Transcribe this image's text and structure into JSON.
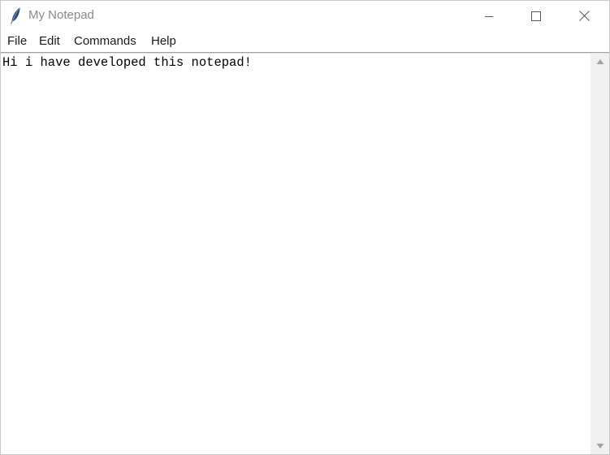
{
  "window": {
    "title": "My Notepad",
    "app_icon": "feather-icon",
    "controls": {
      "minimize_icon": "minimize-icon",
      "maximize_icon": "maximize-icon",
      "close_icon": "close-icon"
    }
  },
  "menubar": {
    "items": [
      {
        "label": "File"
      },
      {
        "label": "Edit"
      },
      {
        "label": "Commands"
      },
      {
        "label": "Help"
      }
    ]
  },
  "editor": {
    "content": "Hi i have developed this notepad!"
  },
  "scrollbar": {
    "up_icon": "scroll-up-arrow-icon",
    "down_icon": "scroll-down-arrow-icon"
  },
  "colors": {
    "title_text": "#8a8a8a",
    "menu_text": "#1a1a1a",
    "scrollbar_bg": "#f0f0f0",
    "divider": "#a0a0a0"
  }
}
